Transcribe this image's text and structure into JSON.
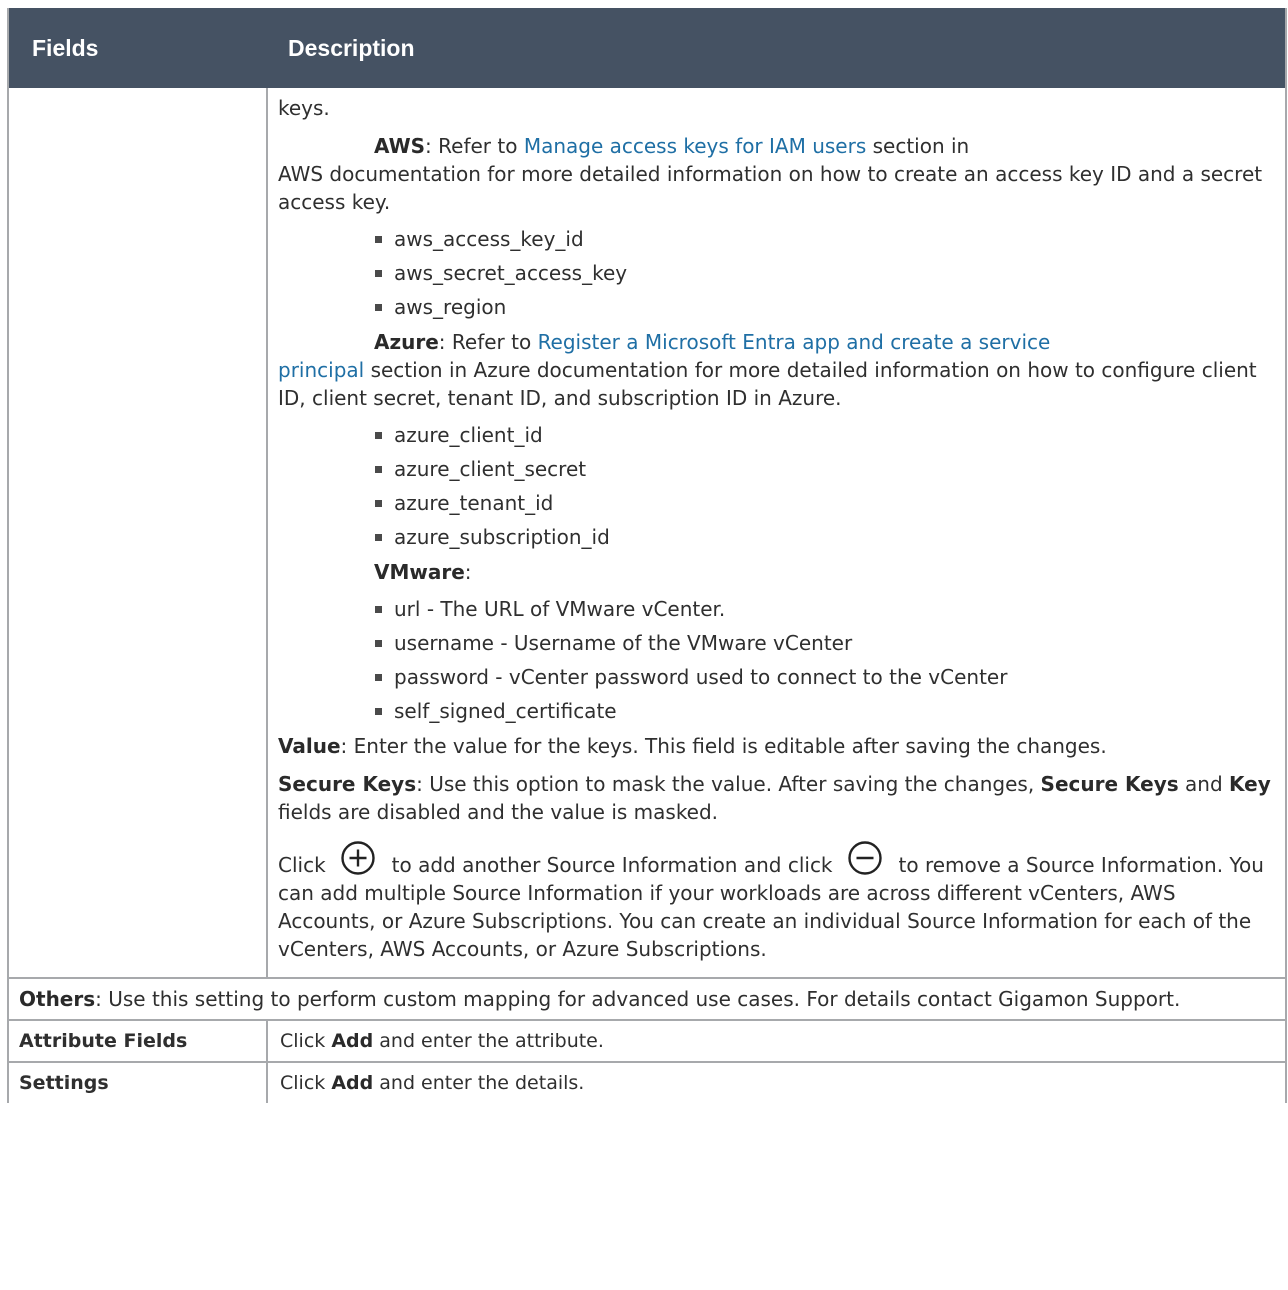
{
  "header": {
    "col_fields": "Fields",
    "col_description": "Description"
  },
  "desc": {
    "keys_tail": "keys.",
    "aws_label": "AWS",
    "aws_prefix": ": Refer to ",
    "aws_link": "Manage access keys for IAM users",
    "aws_suffix": " section in",
    "aws_text2": "AWS documentation for more detailed information on how to create an access key ID and a secret access key.",
    "aws_items": [
      "aws_access_key_id",
      "aws_secret_access_key",
      "aws_region"
    ],
    "azure_label": "Azure",
    "azure_prefix": ": Refer to ",
    "azure_link_line1": "Register a Microsoft Entra app and create a service",
    "azure_link_line2": "principal",
    "azure_suffix": " section in Azure documentation for more detailed information on how to configure client ID, client secret, tenant ID, and subscription ID in Azure.",
    "azure_items": [
      "azure_client_id",
      "azure_client_secret",
      "azure_tenant_id",
      "azure_subscription_id"
    ],
    "vmware_label": "VMware",
    "vmware_colon": ":",
    "vmware_items": [
      "url - The URL of VMware vCenter.",
      "username - Username of the VMware vCenter",
      "password - vCenter password used to connect to the vCenter",
      "self_signed_certificate"
    ],
    "value_label": "Value",
    "value_text": ": Enter the value for the keys. This field is editable after saving the changes.",
    "secure_label": "Secure Keys",
    "secure_text1": ": Use this option to mask the value. After saving the changes, ",
    "secure_label2": "Secure Keys",
    "secure_text2": " and ",
    "key_label": "Key",
    "secure_text3": " fields are disabled and the value is masked.",
    "click_word": "Click",
    "add_text": "to add another Source Information and click",
    "remove_text": "to remove a Source Information. You can add multiple Source Information if your workloads are across different vCenters, AWS Accounts, or Azure Subscriptions. You can create an individual Source Information for each of the vCenters, AWS Accounts, or Azure Subscriptions.",
    "add_icon": "plus-circle-icon",
    "remove_icon": "minus-circle-icon"
  },
  "others": {
    "label": "Others",
    "text": ": Use this setting to perform custom mapping for advanced use cases. For details contact Gigamon Support."
  },
  "rows": [
    {
      "field": "Attribute Fields",
      "pre": "Click ",
      "bold": "Add",
      "post": " and enter the attribute."
    },
    {
      "field": "Settings",
      "pre": "Click ",
      "bold": "Add",
      "post": " and enter the details."
    }
  ]
}
